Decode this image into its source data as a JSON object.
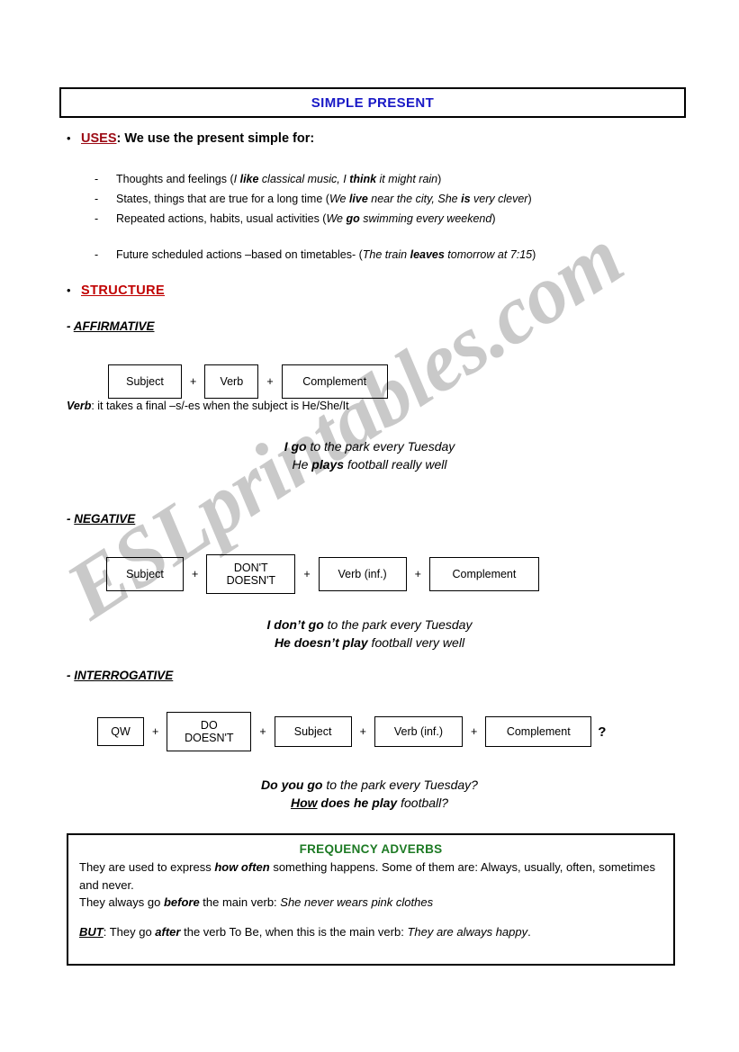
{
  "document": {
    "title": "SIMPLE PRESENT",
    "watermark": "ESLprintables.com"
  },
  "uses": {
    "label": "USES",
    "intro": ": We use the present simple for:",
    "items": [
      {
        "lead": "Thoughts and feelings (",
        "parts": [
          {
            "text": "I ",
            "style": "italic"
          },
          {
            "text": "like",
            "style": "bold-italic"
          },
          {
            "text": " classical music, ",
            "style": "italic"
          },
          {
            "text": "I ",
            "style": "italic"
          },
          {
            "text": "think",
            "style": "bold-italic"
          },
          {
            "text": " it  might rain",
            "style": "italic"
          }
        ],
        "tail": ")"
      },
      {
        "lead": "States, things that are true for a long time (",
        "parts": [
          {
            "text": "We ",
            "style": "italic"
          },
          {
            "text": "live",
            "style": "bold-italic"
          },
          {
            "text": " near the city, ",
            "style": "italic"
          },
          {
            "text": "She ",
            "style": "italic"
          },
          {
            "text": "is",
            "style": "bold-italic"
          },
          {
            "text": " very clever",
            "style": "italic"
          }
        ],
        "tail": ")"
      },
      {
        "lead": "Repeated actions, habits, usual activities (",
        "parts": [
          {
            "text": "We ",
            "style": "italic"
          },
          {
            "text": "go",
            "style": "bold-italic"
          },
          {
            "text": " swimming every weekend",
            "style": "italic"
          }
        ],
        "tail": ")"
      },
      {
        "lead": "Future scheduled actions –based on timetables- (",
        "parts": [
          {
            "text": "The train ",
            "style": "italic"
          },
          {
            "text": "leaves",
            "style": "bold-italic"
          },
          {
            "text": " tomorrow at 7:15",
            "style": "italic"
          }
        ],
        "tail": ")"
      }
    ],
    "dash_mark": "-"
  },
  "structure": {
    "label": "STRUCTURE",
    "affirmative": {
      "heading_prefix": "- ",
      "heading": "AFFIRMATIVE",
      "boxes": [
        "Subject",
        "Verb",
        "Complement"
      ],
      "plus": "+",
      "note_bold": "Verb",
      "note_rest": ": it takes a final –s/-es when the subject is He/She/It",
      "examples": [
        [
          {
            "text": "I ",
            "style": "bold-italic"
          },
          {
            "text": "go",
            "style": "bold-italic"
          },
          {
            "text": " to the park every Tuesday",
            "style": "italic"
          }
        ],
        [
          {
            "text": "He ",
            "style": "italic"
          },
          {
            "text": "plays",
            "style": "bold-italic"
          },
          {
            "text": " football really well",
            "style": "italic"
          }
        ]
      ]
    },
    "negative": {
      "heading_prefix": "- ",
      "heading": "NEGATIVE",
      "boxes": [
        "Subject",
        "DON'T\nDOESN'T",
        "Verb (inf.)",
        "Complement"
      ],
      "plus": "+",
      "examples": [
        [
          {
            "text": "I ",
            "style": "bold-italic"
          },
          {
            "text": "don’t go",
            "style": "bold-italic"
          },
          {
            "text": " to the park every Tuesday",
            "style": "italic"
          }
        ],
        [
          {
            "text": "He ",
            "style": "bold-italic"
          },
          {
            "text": "doesn’t play",
            "style": "bold-italic"
          },
          {
            "text": " football very well",
            "style": "italic"
          }
        ]
      ]
    },
    "interrogative": {
      "heading_prefix": "- ",
      "heading": "INTERROGATIVE",
      "boxes": [
        "QW",
        "DO\nDOESN'T",
        "Subject",
        "Verb (inf.)",
        "Complement"
      ],
      "plus": "+",
      "question_mark": "?",
      "examples": [
        [
          {
            "text": "Do you go",
            "style": "bold-italic"
          },
          {
            "text": " to the park every Tuesday?",
            "style": "italic"
          }
        ],
        [
          {
            "text": "How",
            "style": "underline-bold-italic"
          },
          {
            "text": " does he play",
            "style": "bold-italic"
          },
          {
            "text": " football?",
            "style": "italic"
          }
        ]
      ]
    }
  },
  "frequency_adverbs": {
    "title": "FREQUENCY ADVERBS",
    "lines": [
      [
        {
          "text": "They are used to express ",
          "style": "normal"
        },
        {
          "text": "how often",
          "style": "bold-italic"
        },
        {
          "text": " something happens. Some of them are: Always, usually, often, sometimes and never.",
          "style": "normal"
        }
      ],
      [
        {
          "text": "They always go ",
          "style": "normal"
        },
        {
          "text": "before",
          "style": "bold-italic"
        },
        {
          "text": " the main verb: ",
          "style": "normal"
        },
        {
          "text": "She never wears pink clothes",
          "style": "italic"
        }
      ],
      [
        {
          "text": "BUT",
          "style": "underline-bold"
        },
        {
          "text": ": They go ",
          "style": "normal"
        },
        {
          "text": "after",
          "style": "bold-italic"
        },
        {
          "text": " the verb To Be, when this is the main verb: ",
          "style": "normal"
        },
        {
          "text": "They are always happy",
          "style": "italic"
        },
        {
          "text": ".",
          "style": "normal"
        }
      ]
    ]
  },
  "colors": {
    "title_blue": "#1919c6",
    "uses_red": "#9c0a14",
    "structure_red": "#c00000",
    "freq_green": "#1d7a24",
    "watermark_gray": "#c9c9c9"
  }
}
